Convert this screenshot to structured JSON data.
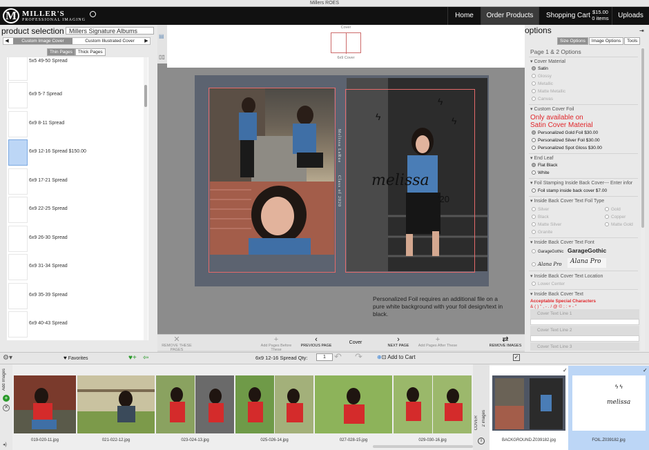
{
  "window_title": "Millers ROES",
  "brand": {
    "name": "MILLER'S",
    "sub": "PROFESSIONAL IMAGING",
    "logo_letter": "M"
  },
  "nav": {
    "home": "Home",
    "order_products": "Order Products",
    "shopping_cart": "Shopping Cart",
    "cart_total": "$15.00",
    "cart_items": "0 items",
    "uploads": "Uploads"
  },
  "product_selection": {
    "title": "product selection",
    "selected_product": "Millers Signature Albums",
    "tab_prev": "◀",
    "tab_active": "Custom Image Cover",
    "tab_other": "Custom Illustrated Cover",
    "tab_next": "▶",
    "seg_thin": "Thin Pages",
    "seg_thick": "Thick Pages",
    "items": [
      {
        "label": "5x5 49-50 Spread",
        "selected": false
      },
      {
        "label": "6x9 5-7 Spread",
        "selected": false
      },
      {
        "label": "6x9 8-11 Spread",
        "selected": false
      },
      {
        "label": "6x9 12-16 Spread $150.00",
        "selected": true
      },
      {
        "label": "6x9 17-21 Spread",
        "selected": false
      },
      {
        "label": "6x9 22-25 Spread",
        "selected": false
      },
      {
        "label": "6x9 26-30 Spread",
        "selected": false
      },
      {
        "label": "6x9 31-34 Spread",
        "selected": false
      },
      {
        "label": "6x9 35-39 Spread",
        "selected": false
      },
      {
        "label": "6x9 40-43 Spread",
        "selected": false
      }
    ],
    "favorites": "Favorites"
  },
  "cover": {
    "top_label": "Cover",
    "bottom_label": "6x9 Cover"
  },
  "spread": {
    "spine_name": "Melissa LaRue",
    "spine_class": "Class of 2020",
    "script_name": "melissa",
    "year": "'20",
    "foil_note": "Personalized Foil requires an additional file on a pure white background with your foil design/text in black."
  },
  "toolbar": {
    "remove_pages": "REMOVE THESE PAGES",
    "add_before": "Add Pages Before These",
    "previous": "PREVIOUS PAGE",
    "current": "Cover",
    "next": "NEXT PAGE",
    "add_after": "Add Pages After These",
    "remove_images": "REMOVE IMAGES"
  },
  "qty": {
    "label": "6x9 12-16 Spread Qty:",
    "value": "1",
    "add_to_cart": "Add to Cart"
  },
  "options": {
    "title": "options",
    "tabs": [
      "Size Options",
      "Image Options",
      "Tools"
    ],
    "page_options": "Page 1 & 2 Options",
    "cover_material": "Cover Material",
    "materials": [
      "Satin",
      "Glossy",
      "Metallic",
      "Matte Metallic",
      "Canvas"
    ],
    "custom_foil": "Custom Cover Foil",
    "foil_warning_1": "Only available on",
    "foil_warning_2": "Satin Cover Material",
    "foil_options": [
      "Personalized Gold Foil $30.00",
      "Personalized Silver Foil $30.00",
      "Personalized Spot Gloss $30.00"
    ],
    "end_leaf": "End Leaf",
    "leafs": [
      "Flat Black",
      "White"
    ],
    "foil_inside": "Foil Stamping Inside Back Cover--- Enter infor",
    "foil_inside_opt": "Foil stamp inside back cover $7.00",
    "text_foil_type": "Inside Back Cover Text Foil Type",
    "foil_types_left": [
      "Silver",
      "Black",
      "Matte Silver",
      "Granite"
    ],
    "foil_types_right": [
      "Gold",
      "Copper",
      "Matte Gold"
    ],
    "text_font": "Inside Back Cover Text Font",
    "font_samples": [
      "GarageGothic",
      "GarageGothic",
      "Alana Pro",
      "Alana Pro"
    ],
    "text_location": "Inside Back Cover Text Location",
    "location_opt": "Lower Center",
    "cover_text": "Inside Back Cover Text",
    "special_chars_title": "Acceptable Special Characters",
    "special_chars": "& ( ) \" , - . / @ © ; : + - \"",
    "text_lines": [
      "Cover Text Line 1",
      "Cover Text Line 2",
      "Cover Text Line 3"
    ]
  },
  "filmstrip": {
    "add_images": "Add Images",
    "images": [
      "019-020-11.jpg",
      "021-022-12.jpg",
      "023-024-13.jpg",
      "025-026-14.jpg",
      "027-028-15.jpg",
      "029-030-16.jpg"
    ],
    "cover_label": "COVER",
    "cover_count": "2 images",
    "cover_images": [
      "BACKGROUND.Z039182.jpg",
      "FOIL.Z039182.jpg"
    ]
  },
  "colors": {
    "nav_bg": "#111111",
    "accent_red": "#e0262a",
    "selection_blue": "#bcd6f6",
    "spread_bg": "#5c6370"
  }
}
